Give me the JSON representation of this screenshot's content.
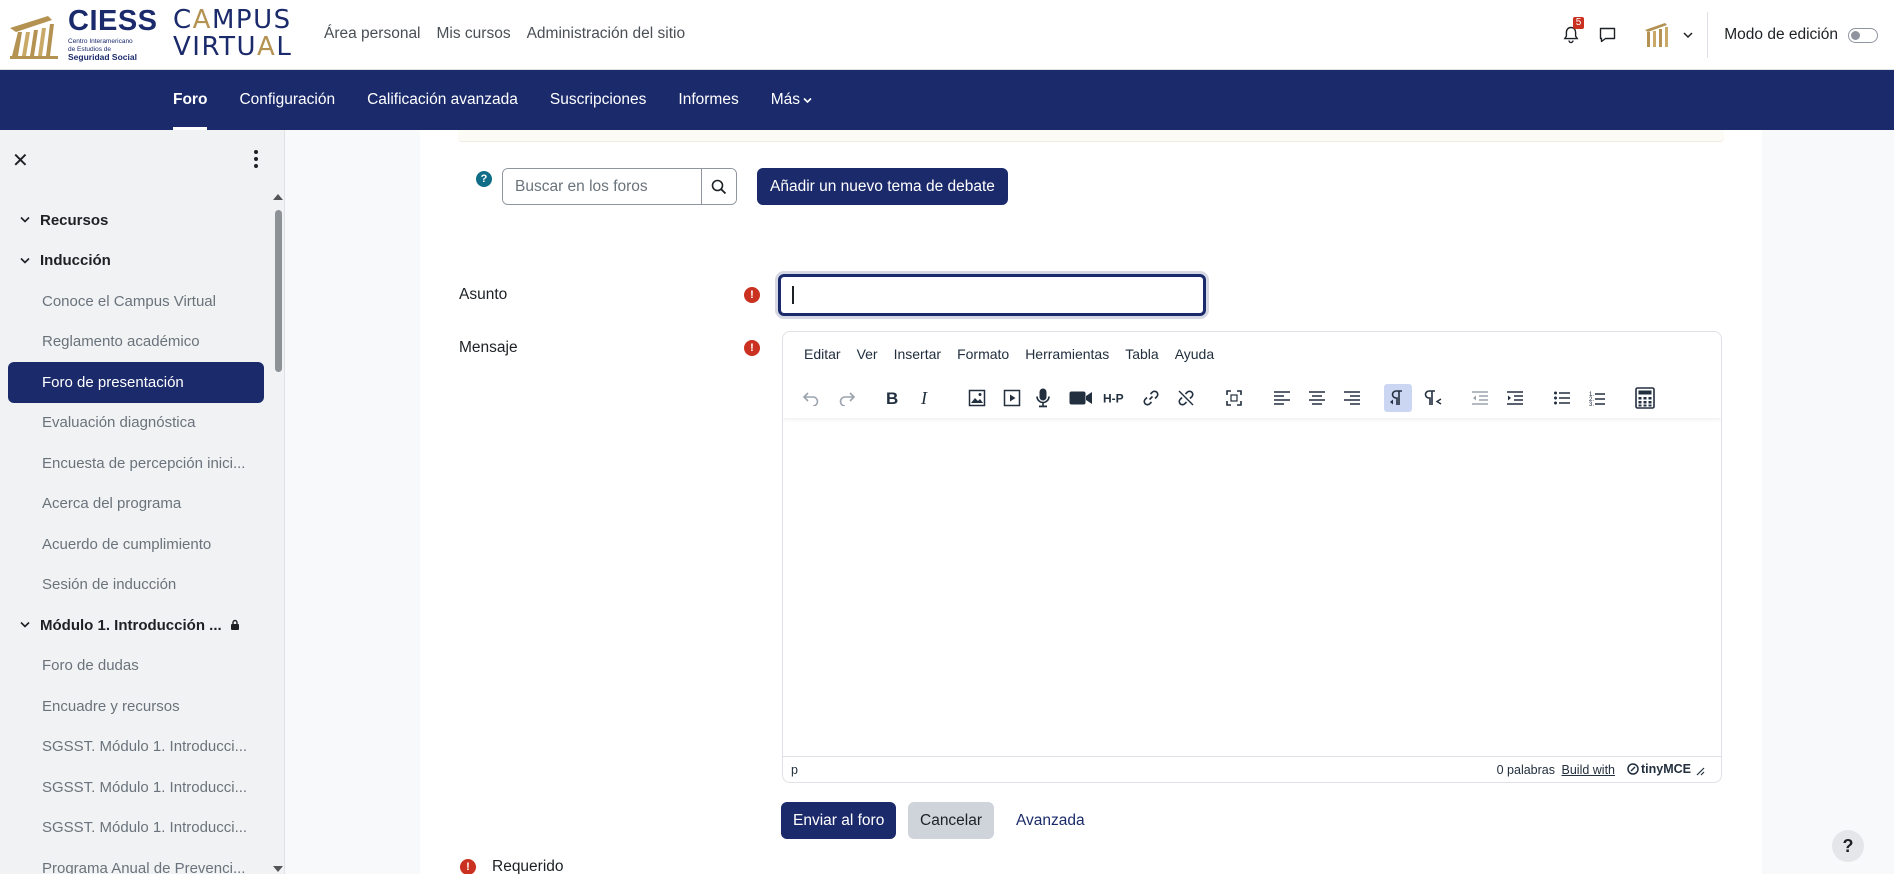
{
  "brand": {
    "ciess_name": "CIESS",
    "ciess_sub1": "Centro Interamericano",
    "ciess_sub2": "de Estudios de",
    "ciess_sub3": "Seguridad Social",
    "campus_line1": "CAMPUS",
    "campus_line2": "VIRTUAL",
    "gold": "#b49252",
    "navy": "#1b2a6b"
  },
  "header": {
    "nav": [
      "Área personal",
      "Mis cursos",
      "Administración del sitio"
    ],
    "notifications_count": "5",
    "edit_mode_label": "Modo de edición"
  },
  "secondary_nav": {
    "items": [
      "Foro",
      "Configuración",
      "Calificación avanzada",
      "Suscripciones",
      "Informes",
      "Más"
    ],
    "active": "Foro"
  },
  "drawer": {
    "sections": [
      {
        "label": "Recursos",
        "items": []
      },
      {
        "label": "Inducción",
        "items": [
          "Conoce el Campus Virtual",
          "Reglamento académico",
          "Foro de presentación",
          "Evaluación diagnóstica",
          "Encuesta de percepción inici...",
          "Acerca del programa",
          "Acuerdo de cumplimiento",
          "Sesión de inducción"
        ]
      },
      {
        "label": "Módulo 1. Introducción ...",
        "items": [
          "Foro de dudas",
          "Encuadre y recursos",
          "SGSST. Módulo 1. Introducci...",
          "SGSST. Módulo 1. Introducci...",
          "SGSST. Módulo 1. Introducci...",
          "Programa Anual de Prevenci..."
        ]
      }
    ],
    "active_item": "Foro de presentación"
  },
  "forum": {
    "search_placeholder": "Buscar en los foros",
    "add_topic_label": "Añadir un nuevo tema de debate",
    "subject_label": "Asunto",
    "subject_value": "",
    "message_label": "Mensaje",
    "editor_menu": [
      "Editar",
      "Ver",
      "Insertar",
      "Formato",
      "Herramientas",
      "Tabla",
      "Ayuda"
    ],
    "status_path": "p",
    "word_count": "0 palabras",
    "build_with": "Build with",
    "tinymce": "tinyMCE",
    "send_label": "Enviar al foro",
    "cancel_label": "Cancelar",
    "advanced_label": "Avanzada",
    "required_label": "Requerido"
  },
  "help_label": "?"
}
